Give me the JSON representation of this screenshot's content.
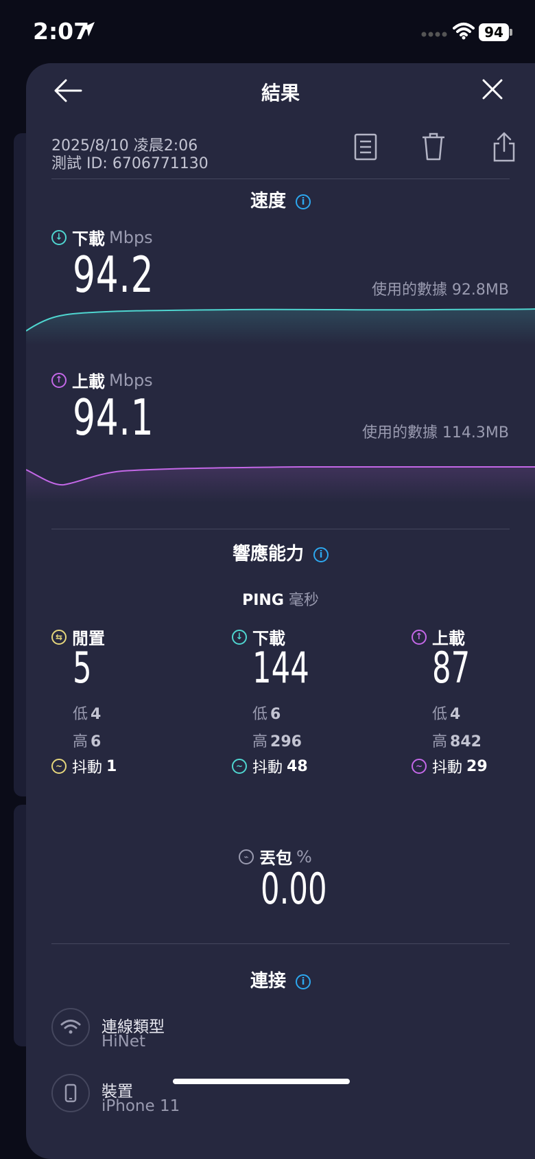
{
  "status_bar": {
    "time": "2:07",
    "battery": "94"
  },
  "header": {
    "title": "結果"
  },
  "meta": {
    "datetime": "2025/8/10 凌晨2:06",
    "test_id": "測試 ID: 6706771130"
  },
  "speed": {
    "title": "速度",
    "download": {
      "label": "下載",
      "unit": "Mbps",
      "value": "94.2",
      "data_used": "使用的數據 92.8MB"
    },
    "upload": {
      "label": "上載",
      "unit": "Mbps",
      "value": "94.1",
      "data_used": "使用的數據 114.3MB"
    }
  },
  "responsiveness": {
    "title": "響應能力",
    "ping_label": "PING",
    "ping_unit": "毫秒",
    "columns": [
      {
        "label": "閒置",
        "value": "5",
        "low_label": "低",
        "low": "4",
        "high_label": "高",
        "high": "6",
        "jitter_label": "抖動",
        "jitter": "1"
      },
      {
        "label": "下載",
        "value": "144",
        "low_label": "低",
        "low": "6",
        "high_label": "高",
        "high": "296",
        "jitter_label": "抖動",
        "jitter": "48"
      },
      {
        "label": "上載",
        "value": "87",
        "low_label": "低",
        "low": "4",
        "high_label": "高",
        "high": "842",
        "jitter_label": "抖動",
        "jitter": "29"
      }
    ],
    "packet_loss": {
      "label": "丟包",
      "unit": "%",
      "value": "0.00"
    }
  },
  "connection": {
    "title": "連接",
    "items": [
      {
        "label": "連線類型",
        "value": "HiNet",
        "icon": "wifi-icon"
      },
      {
        "label": "裝置",
        "value": "iPhone 11",
        "icon": "phone-icon"
      }
    ]
  },
  "colors": {
    "download": "#4fd6d0",
    "upload": "#c468e8",
    "idle": "#e6d77c",
    "info": "#2da8f0"
  }
}
